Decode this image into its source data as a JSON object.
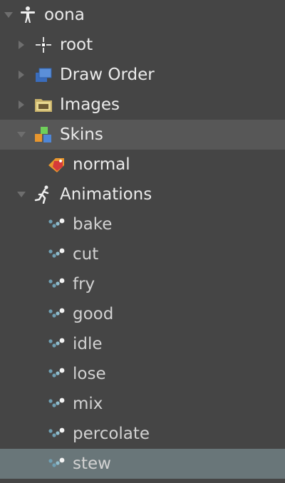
{
  "tree": {
    "root_label": "oona",
    "root_icon": "skeleton-figure-icon",
    "items": [
      {
        "label": "root",
        "icon": "bone-crosshair-icon"
      },
      {
        "label": "Draw Order",
        "icon": "draw-order-icon"
      },
      {
        "label": "Images",
        "icon": "folder-icon"
      },
      {
        "label": "Skins",
        "icon": "skins-blocks-icon"
      },
      {
        "label": "normal",
        "icon": "skin-tag-icon"
      },
      {
        "label": "Animations",
        "icon": "running-figure-icon"
      }
    ],
    "animations": [
      "bake",
      "cut",
      "fry",
      "good",
      "idle",
      "lose",
      "mix",
      "percolate",
      "stew"
    ],
    "animation_icon": "animation-dots-icon",
    "selected": "stew",
    "colors": {
      "background": "#454545",
      "skins_highlight": "#575757",
      "selected_highlight": "#697679",
      "text": "#ebebeb",
      "arrow": "#6e6e6e"
    }
  }
}
